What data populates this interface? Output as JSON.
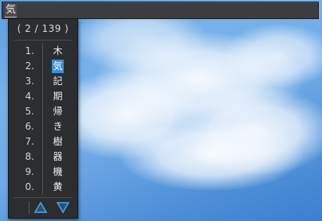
{
  "input": {
    "preedit_text": "気"
  },
  "candidates": {
    "counter": "( 2 / 139 )",
    "selected_index": 1,
    "items": [
      {
        "number": "1.",
        "text": "木"
      },
      {
        "number": "2.",
        "text": "気"
      },
      {
        "number": "3.",
        "text": "記"
      },
      {
        "number": "4.",
        "text": "期"
      },
      {
        "number": "5.",
        "text": "帰"
      },
      {
        "number": "6.",
        "text": "き"
      },
      {
        "number": "7.",
        "text": "樹"
      },
      {
        "number": "8.",
        "text": "器"
      },
      {
        "number": "9.",
        "text": "機"
      },
      {
        "number": "0.",
        "text": "黄"
      }
    ]
  },
  "navigation": {
    "prev_icon": "up-triangle-icon",
    "next_icon": "down-triangle-icon"
  },
  "colors": {
    "selection": "#3d8fd6",
    "window_bg": "#2c2d30",
    "arrow": "#4aa6e8"
  }
}
